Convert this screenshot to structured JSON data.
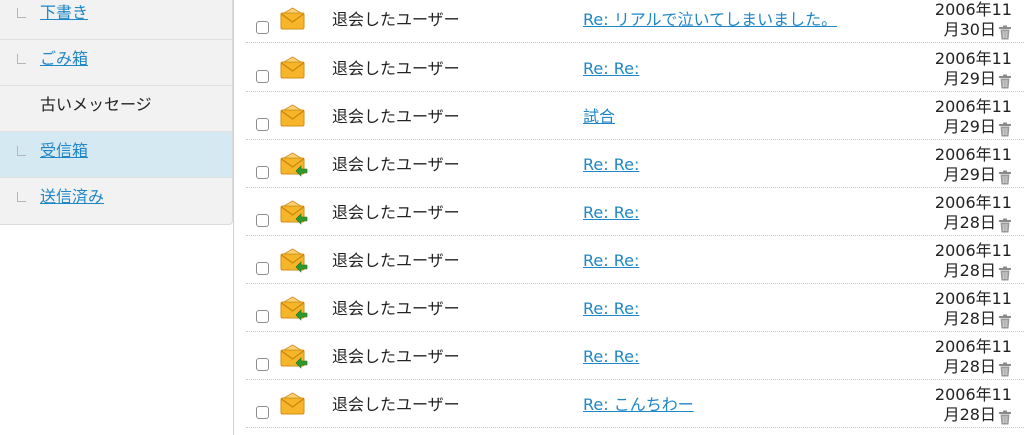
{
  "sidebar": {
    "items": [
      {
        "label": "下書き",
        "link": true,
        "selected": false
      },
      {
        "label": "ごみ箱",
        "link": true,
        "selected": false
      },
      {
        "label": "古いメッセージ",
        "link": false,
        "selected": false
      },
      {
        "label": "受信箱",
        "link": true,
        "selected": true
      },
      {
        "label": "送信済み",
        "link": true,
        "selected": false
      }
    ]
  },
  "messages": [
    {
      "sender": "退会したユーザー",
      "subject": "Re: リアルで泣いてしまいました。",
      "date_line1": "2006年11",
      "date_line2": "月30日",
      "icon": "envelope-icon"
    },
    {
      "sender": "退会したユーザー",
      "subject": "Re: Re:",
      "date_line1": "2006年11",
      "date_line2": "月29日",
      "icon": "envelope-icon"
    },
    {
      "sender": "退会したユーザー",
      "subject": "試合",
      "date_line1": "2006年11",
      "date_line2": "月29日",
      "icon": "envelope-icon"
    },
    {
      "sender": "退会したユーザー",
      "subject": "Re: Re:",
      "date_line1": "2006年11",
      "date_line2": "月29日",
      "icon": "envelope-replied-icon"
    },
    {
      "sender": "退会したユーザー",
      "subject": "Re: Re:",
      "date_line1": "2006年11",
      "date_line2": "月28日",
      "icon": "envelope-replied-icon"
    },
    {
      "sender": "退会したユーザー",
      "subject": "Re: Re:",
      "date_line1": "2006年11",
      "date_line2": "月28日",
      "icon": "envelope-replied-icon"
    },
    {
      "sender": "退会したユーザー",
      "subject": "Re: Re:",
      "date_line1": "2006年11",
      "date_line2": "月28日",
      "icon": "envelope-replied-icon"
    },
    {
      "sender": "退会したユーザー",
      "subject": "Re: Re:",
      "date_line1": "2006年11",
      "date_line2": "月28日",
      "icon": "envelope-replied-icon"
    },
    {
      "sender": "退会したユーザー",
      "subject": "Re: こんちわー",
      "date_line1": "2006年11",
      "date_line2": "月28日",
      "icon": "envelope-icon"
    }
  ],
  "colors": {
    "link": "#1f86c7",
    "selected_bg": "#d5e9f3",
    "sidebar_bg": "#f2f2f2",
    "envelope": "#f7b52a",
    "reply_arrow": "#2e9a2e"
  }
}
